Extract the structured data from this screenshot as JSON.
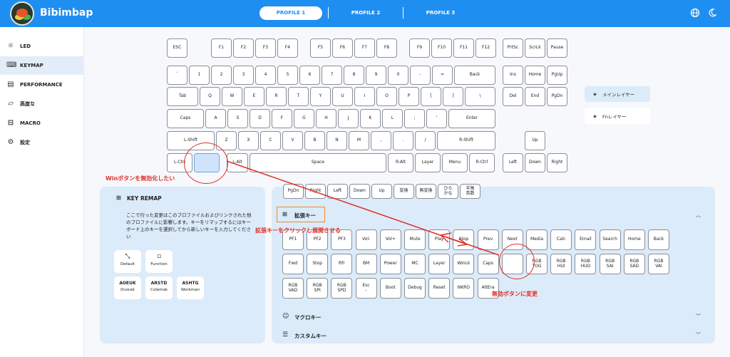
{
  "app": {
    "title": "Bibimbap"
  },
  "profiles": [
    "PROFILE 1",
    "PROFILE 2",
    "PROFILE 3"
  ],
  "sidebar": {
    "items": [
      {
        "label": "LED",
        "icon": "sun-icon"
      },
      {
        "label": "KEYMAP",
        "icon": "keyboard-icon"
      },
      {
        "label": "PERFORMANCE",
        "icon": "performance-icon"
      },
      {
        "label": "高度な",
        "icon": "advanced-icon"
      },
      {
        "label": "MACRO",
        "icon": "macro-icon"
      },
      {
        "label": "設定",
        "icon": "gear-icon"
      }
    ]
  },
  "layers": {
    "main": "メインレイヤー",
    "fn": "Fnレイヤー"
  },
  "keyboard": {
    "rows": [
      [
        "ESC",
        "F1",
        "F2",
        "F3",
        "F4",
        "F5",
        "F6",
        "F7",
        "F8",
        "F9",
        "F10",
        "F11",
        "F12",
        "PrtSc",
        "ScrLk",
        "Pause"
      ],
      [
        "`",
        "1",
        "2",
        "3",
        "4",
        "5",
        "6",
        "7",
        "8",
        "9",
        "0",
        "-",
        "=",
        "Back",
        "Ins",
        "Home",
        "PgUp"
      ],
      [
        "Tab",
        "Q",
        "W",
        "E",
        "R",
        "T",
        "Y",
        "U",
        "I",
        "O",
        "P",
        "[",
        "]",
        "\\",
        "Del",
        "End",
        "PgDn"
      ],
      [
        "Caps",
        "A",
        "S",
        "D",
        "F",
        "G",
        "H",
        "J",
        "K",
        "L",
        ";",
        "'",
        "Enter"
      ],
      [
        "L-Shift",
        "Z",
        "X",
        "C",
        "V",
        "B",
        "N",
        "M",
        ",",
        ".",
        "/",
        "R-Shift",
        "Up"
      ],
      [
        "L-Ctrl",
        "",
        "L-Alt",
        "Space",
        "R-Alt",
        "Layer",
        "Menu",
        "R-Ctrl",
        "Left",
        "Down",
        "Right"
      ]
    ]
  },
  "remap": {
    "title": "KEY REMAP",
    "description": "ここで行った変更はこのプロファイルおよびリンクされた他のプロファイルに影響します。キーをリマップするにはキーボード上のキーを選択してから新しいキーを入力してください",
    "default": "Default",
    "function": "Function",
    "layouts": [
      {
        "top": "AOEUK",
        "bottom": "Dvorak"
      },
      {
        "top": "ARSTD",
        "bottom": "Colemak"
      },
      {
        "top": "ASHTG",
        "bottom": "Workman"
      }
    ]
  },
  "extended": {
    "top_row": [
      "PgDn",
      "Right",
      "Left",
      "Down",
      "Up",
      "変換",
      "無変換",
      "ひら\nかな",
      "半角\n英数"
    ],
    "title": "拡張キー",
    "rows": [
      [
        "PF1",
        "PF2",
        "PF3",
        "Vol-",
        "Vol+",
        "Mute",
        "Play",
        "Stop",
        "Prev",
        "Next",
        "Media",
        "Calc",
        "Email",
        "Search",
        "Home",
        "Back"
      ],
      [
        "Fwd",
        "Stop",
        "Rfr",
        "BM",
        "Power",
        "MC",
        "Layer",
        "WinLk",
        "Caps",
        "",
        "RGB\nTOG",
        "RGB\nHUI",
        "RGB\nHUD",
        "RGB\nSAI",
        "RGB\nSAD",
        "RGB\nVAI"
      ],
      [
        "RGB\nVAD",
        "RGB\nSPI",
        "RGB\nSPD",
        "Esc\n-",
        "Boot",
        "Debug",
        "Reset",
        "NKRO",
        "AltEra"
      ]
    ],
    "macro": "マクロキー",
    "custom": "カスタムキー"
  },
  "annotations": {
    "win": "Winボタンを無効化したい",
    "ext": "拡張キーをクリックし展開させる",
    "blank": "無効ボタンに変更"
  },
  "colors": {
    "accent": "#1f8ef1",
    "annotation": "#e0322a",
    "highlight": "#f08a2a"
  }
}
